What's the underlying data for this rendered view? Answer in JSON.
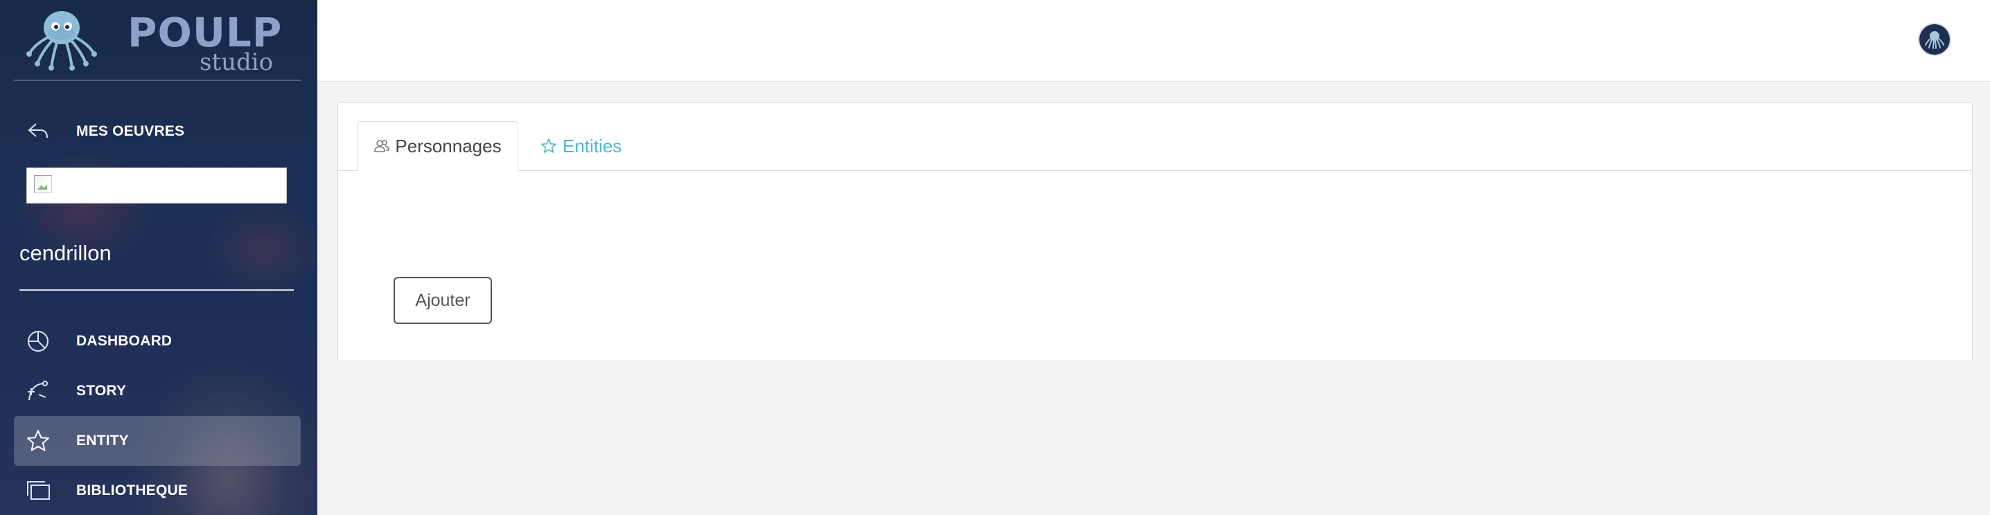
{
  "brand": {
    "name_main": "POULP",
    "name_sub": "studio",
    "logo_icon": "octopus-logo-icon",
    "colors": {
      "poulp": "#8da2c9",
      "studio": "#8ea2c4",
      "octopus": "#7fb3d0"
    }
  },
  "sidebar": {
    "back_item": {
      "label": "MES OEUVRES",
      "icon": "back-arrow-icon"
    },
    "project_image_alt": "",
    "project_name": "cendrillon",
    "items": [
      {
        "label": "DASHBOARD",
        "icon": "pie-chart-icon",
        "active": false
      },
      {
        "label": "STORY",
        "icon": "curve-path-icon",
        "active": false
      },
      {
        "label": "ENTITY",
        "icon": "star-icon",
        "active": true
      },
      {
        "label": "BIBLIOTHEQUE",
        "icon": "windows-icon",
        "active": false
      }
    ]
  },
  "header": {
    "avatar_icon": "user-avatar-octopus-icon"
  },
  "main": {
    "tabs": [
      {
        "label": "Personnages",
        "icon": "users-icon",
        "active": true
      },
      {
        "label": "Entities",
        "icon": "star-outline-icon",
        "active": false
      }
    ],
    "add_button_label": "Ajouter"
  },
  "colors": {
    "sidebar_bg": "#1c2f55",
    "accent_link": "#4fb8d8",
    "page_bg": "#f3f3f3"
  }
}
